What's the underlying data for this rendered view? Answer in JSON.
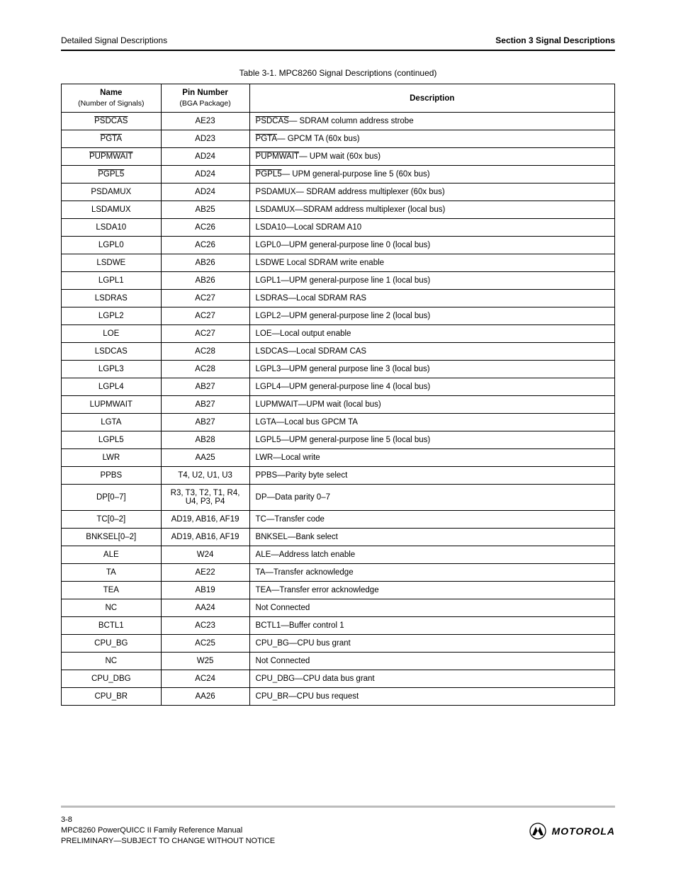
{
  "header": {
    "section": "Section 3 Signal Descriptions",
    "running": "Detailed Signal Descriptions"
  },
  "caption": "Table 3-1. MPC8260 Signal Descriptions (continued)",
  "thead": {
    "c0": "Name",
    "c0_sub": "(Number of Signals)",
    "c1": "Pin Number",
    "c1_sub": "(BGA Package)",
    "c2": "Description"
  },
  "rows": [
    {
      "name": "PSDCAS",
      "over": "PSDCAS",
      "pin": "AE23",
      "desc": "— SDRAM column address strobe"
    },
    {
      "name": "PGTA",
      "over": "PGTA",
      "pin": "AD23",
      "desc": "— GPCM TA (60x bus)"
    },
    {
      "name": "PUPMWAIT",
      "over": "PUPMWAIT",
      "pin": "AD24",
      "desc": "— UPM wait (60x bus)"
    },
    {
      "name": "PGPL5",
      "over": "PGPL5",
      "pin": "AD24",
      "desc": "— UPM general-purpose line 5 (60x bus)"
    },
    {
      "name": "PSDAMUX",
      "over": "",
      "pin": "AD24",
      "desc": "PSDAMUX— SDRAM address multiplexer (60x bus)"
    },
    {
      "name": "LSDAMUX",
      "over": "",
      "pin": "AB25",
      "desc": "LSDAMUX—SDRAM address multiplexer (local bus)"
    },
    {
      "name": "LSDA10",
      "over": "",
      "pin": "AC26",
      "desc": "LSDA10—Local SDRAM A10"
    },
    {
      "name": "LGPL0",
      "over": "",
      "pin": "AC26",
      "desc": "LGPL0—UPM general-purpose line 0 (local bus)"
    },
    {
      "name": "LSDWE",
      "over": "",
      "pin": "AB26",
      "desc": "LSDWE Local SDRAM write enable"
    },
    {
      "name": "LGPL1",
      "over": "",
      "pin": "AB26",
      "desc": "LGPL1—UPM general-purpose line 1 (local bus)"
    },
    {
      "name": "LSDRAS",
      "over": "",
      "pin": "AC27",
      "desc": "LSDRAS—Local SDRAM RAS"
    },
    {
      "name": "LGPL2",
      "over": "",
      "pin": "AC27",
      "desc": "LGPL2—UPM general-purpose line 2 (local bus)"
    },
    {
      "name": "LOE",
      "over": "",
      "pin": "AC27",
      "desc": "LOE—Local output enable"
    },
    {
      "name": "LSDCAS",
      "over": "",
      "pin": "AC28",
      "desc": "LSDCAS—Local SDRAM CAS"
    },
    {
      "name": "LGPL3",
      "over": "",
      "pin": "AC28",
      "desc": "LGPL3—UPM general purpose line 3 (local bus)"
    },
    {
      "name": "LGPL4",
      "over": "",
      "pin": "AB27",
      "desc": "LGPL4—UPM general-purpose line 4 (local bus)"
    },
    {
      "name": "LUPMWAIT",
      "over": "",
      "pin": "AB27",
      "desc": "LUPMWAIT—UPM wait (local bus)"
    },
    {
      "name": "LGTA",
      "over": "",
      "pin": "AB27",
      "desc": "LGTA—Local bus GPCM TA"
    },
    {
      "name": "LGPL5",
      "over": "",
      "pin": "AB28",
      "desc": "LGPL5—UPM general-purpose line 5 (local bus)"
    },
    {
      "name": "LWR",
      "over": "",
      "pin": "AA25",
      "desc": "LWR—Local write"
    },
    {
      "name": "PPBS",
      "over": "",
      "pin": "T4, U2, U1, U3",
      "desc": "PPBS—Parity byte select"
    },
    {
      "name": "DP[0–7]",
      "over": "",
      "pin": "R3, T3, T2, T1, R4, U4, P3, P4",
      "desc": "DP—Data parity 0–7"
    },
    {
      "name": "TC[0–2]",
      "over": "",
      "pin": "AD19, AB16, AF19",
      "desc": "TC—Transfer code"
    },
    {
      "name": "BNKSEL[0–2]",
      "over": "",
      "pin": "AD19, AB16, AF19",
      "desc": "BNKSEL—Bank select"
    },
    {
      "name": "ALE",
      "over": "",
      "pin": "W24",
      "desc": "ALE—Address latch enable"
    },
    {
      "name": "TA",
      "over": "",
      "pin": "AE22",
      "desc": "TA—Transfer acknowledge"
    },
    {
      "name": "TEA",
      "over": "",
      "pin": "AB19",
      "desc": "TEA—Transfer error acknowledge"
    },
    {
      "name": "NC",
      "over": "",
      "pin": "AA24",
      "desc": "Not Connected"
    },
    {
      "name": "BCTL1",
      "over": "",
      "pin": "AC23",
      "desc": "BCTL1—Buffer control 1"
    },
    {
      "name": "CPU_BG",
      "over": "",
      "pin": "AC25",
      "desc": "CPU_BG—CPU bus grant"
    },
    {
      "name": "NC",
      "over": "",
      "pin": "W25",
      "desc": "Not Connected"
    },
    {
      "name": "CPU_DBG",
      "over": "",
      "pin": "AC24",
      "desc": "CPU_DBG—CPU data bus grant"
    },
    {
      "name": "CPU_BR",
      "over": "",
      "pin": "AA26",
      "desc": "CPU_BR—CPU bus request"
    }
  ],
  "footer": {
    "line1": "MPC8260 PowerQUICC II Family Reference Manual",
    "line2": "3-8",
    "line3": "PRELIMINARY—SUBJECT TO CHANGE WITHOUT NOTICE",
    "brand": "MOTOROLA"
  }
}
